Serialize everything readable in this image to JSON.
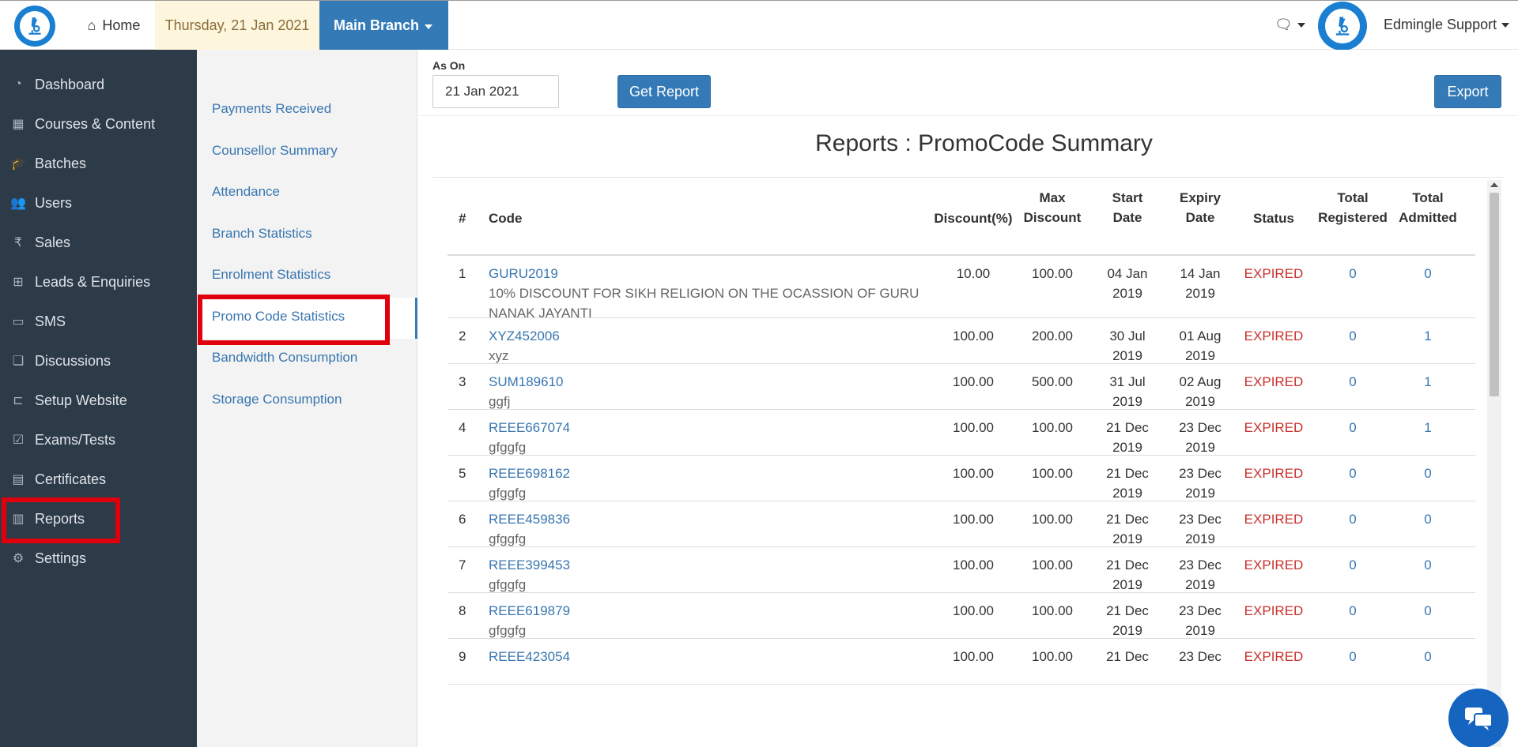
{
  "topbar": {
    "home_label": "Home",
    "date": "Thursday, 21 Jan 2021",
    "branch": "Main Branch",
    "user_name": "Edmingle Support"
  },
  "sidebar": {
    "items": [
      {
        "label": "Dashboard",
        "icon": "dashboard-icon"
      },
      {
        "label": "Courses & Content",
        "icon": "cubes-icon"
      },
      {
        "label": "Batches",
        "icon": "graduation-cap-icon"
      },
      {
        "label": "Users",
        "icon": "users-icon"
      },
      {
        "label": "Sales",
        "icon": "rupee-icon"
      },
      {
        "label": "Leads & Enquiries",
        "icon": "sitemap-icon"
      },
      {
        "label": "SMS",
        "icon": "sms-icon"
      },
      {
        "label": "Discussions",
        "icon": "comments-icon"
      },
      {
        "label": "Setup Website",
        "icon": "laptop-icon"
      },
      {
        "label": "Exams/Tests",
        "icon": "check-square-icon"
      },
      {
        "label": "Certificates",
        "icon": "certificate-icon"
      },
      {
        "label": "Reports",
        "icon": "bar-chart-icon"
      },
      {
        "label": "Settings",
        "icon": "gear-icon"
      }
    ]
  },
  "subnav": {
    "items": [
      "Payments Received",
      "Counsellor Summary",
      "Attendance",
      "Branch Statistics",
      "Enrolment Statistics",
      "Promo Code Statistics",
      "Bandwidth Consumption",
      "Storage Consumption"
    ]
  },
  "filter": {
    "as_on_label": "As On",
    "date_value": "21 Jan 2021",
    "get_report_label": "Get Report",
    "export_label": "Export"
  },
  "report": {
    "title": "Reports : PromoCode Summary",
    "headers": {
      "num": "#",
      "code": "Code",
      "discount": "Discount(%)",
      "max_discount_1": "Max",
      "max_discount_2": "Discount",
      "start_1": "Start",
      "start_2": "Date",
      "expiry_1": "Expiry",
      "expiry_2": "Date",
      "status": "Status",
      "registered_1": "Total",
      "registered_2": "Registered",
      "admitted_1": "Total",
      "admitted_2": "Admitted"
    },
    "rows": [
      {
        "num": "1",
        "code": "GURU2019",
        "desc": "10% DISCOUNT FOR SIKH RELIGION ON THE OCASSION OF GURU NANAK JAYANTI",
        "discount": "10.00",
        "max": "100.00",
        "start_a": "04 Jan",
        "start_b": "2019",
        "exp_a": "14 Jan",
        "exp_b": "2019",
        "status": "EXPIRED",
        "registered": "0",
        "admitted": "0"
      },
      {
        "num": "2",
        "code": "XYZ452006",
        "desc": "xyz",
        "discount": "100.00",
        "max": "200.00",
        "start_a": "30 Jul",
        "start_b": "2019",
        "exp_a": "01 Aug",
        "exp_b": "2019",
        "status": "EXPIRED",
        "registered": "0",
        "admitted": "1"
      },
      {
        "num": "3",
        "code": "SUM189610",
        "desc": "ggfj",
        "discount": "100.00",
        "max": "500.00",
        "start_a": "31 Jul",
        "start_b": "2019",
        "exp_a": "02 Aug",
        "exp_b": "2019",
        "status": "EXPIRED",
        "registered": "0",
        "admitted": "1"
      },
      {
        "num": "4",
        "code": "REEE667074",
        "desc": "gfggfg",
        "discount": "100.00",
        "max": "100.00",
        "start_a": "21 Dec",
        "start_b": "2019",
        "exp_a": "23 Dec",
        "exp_b": "2019",
        "status": "EXPIRED",
        "registered": "0",
        "admitted": "1"
      },
      {
        "num": "5",
        "code": "REEE698162",
        "desc": "gfggfg",
        "discount": "100.00",
        "max": "100.00",
        "start_a": "21 Dec",
        "start_b": "2019",
        "exp_a": "23 Dec",
        "exp_b": "2019",
        "status": "EXPIRED",
        "registered": "0",
        "admitted": "0"
      },
      {
        "num": "6",
        "code": "REEE459836",
        "desc": "gfggfg",
        "discount": "100.00",
        "max": "100.00",
        "start_a": "21 Dec",
        "start_b": "2019",
        "exp_a": "23 Dec",
        "exp_b": "2019",
        "status": "EXPIRED",
        "registered": "0",
        "admitted": "0"
      },
      {
        "num": "7",
        "code": "REEE399453",
        "desc": "gfggfg",
        "discount": "100.00",
        "max": "100.00",
        "start_a": "21 Dec",
        "start_b": "2019",
        "exp_a": "23 Dec",
        "exp_b": "2019",
        "status": "EXPIRED",
        "registered": "0",
        "admitted": "0"
      },
      {
        "num": "8",
        "code": "REEE619879",
        "desc": "gfggfg",
        "discount": "100.00",
        "max": "100.00",
        "start_a": "21 Dec",
        "start_b": "2019",
        "exp_a": "23 Dec",
        "exp_b": "2019",
        "status": "EXPIRED",
        "registered": "0",
        "admitted": "0"
      },
      {
        "num": "9",
        "code": "REEE423054",
        "desc": "",
        "discount": "100.00",
        "max": "100.00",
        "start_a": "21 Dec",
        "start_b": "",
        "exp_a": "23 Dec",
        "exp_b": "",
        "status": "EXPIRED",
        "registered": "0",
        "admitted": "0"
      }
    ]
  }
}
